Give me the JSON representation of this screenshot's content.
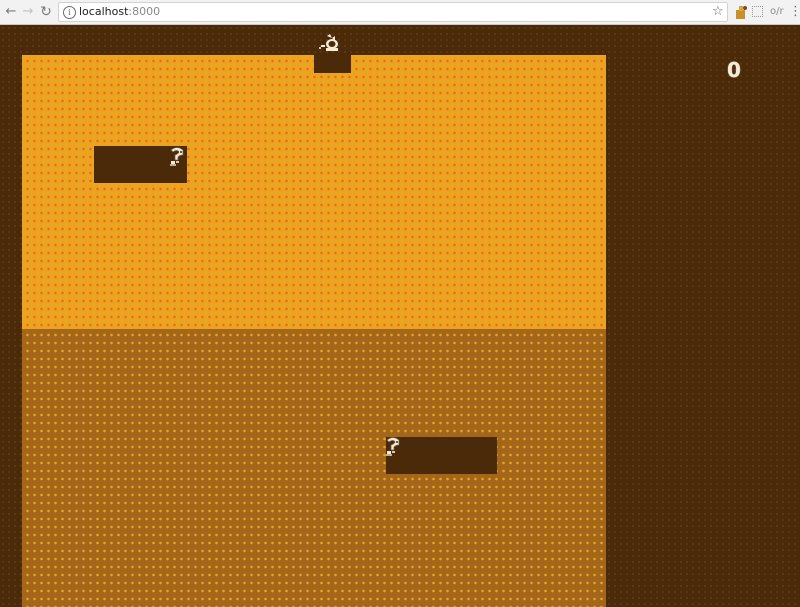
{
  "browser": {
    "back_icon": "arrow-left-icon",
    "forward_icon": "arrow-right-icon",
    "reload_icon": "reload-icon",
    "info_icon": "info-icon",
    "info_glyph": "i",
    "url_host": "localhost",
    "url_port": ":8000",
    "bookmark_icon": "star-icon",
    "extension_icons": [
      "extension-puzzle-icon",
      "extension-dotted-square-icon"
    ],
    "extension_label": "o/r",
    "menu_icon": "more-vert-icon"
  },
  "game": {
    "score": "0",
    "colors": {
      "background": "#4a2a08",
      "upper_room": "#eba420",
      "upper_room_dots": "#ee6a1c",
      "lower_room": "#a3661b",
      "lower_room_dots": "#e2a818",
      "pit": "#4a2a08",
      "score_text": "#f4ead6"
    },
    "sprites": [
      {
        "name": "player-sprite",
        "icon": "cat-icon"
      },
      {
        "name": "enemy-sprite",
        "icon": "creature-icon"
      },
      {
        "name": "enemy-sprite",
        "icon": "creature-icon"
      }
    ]
  }
}
